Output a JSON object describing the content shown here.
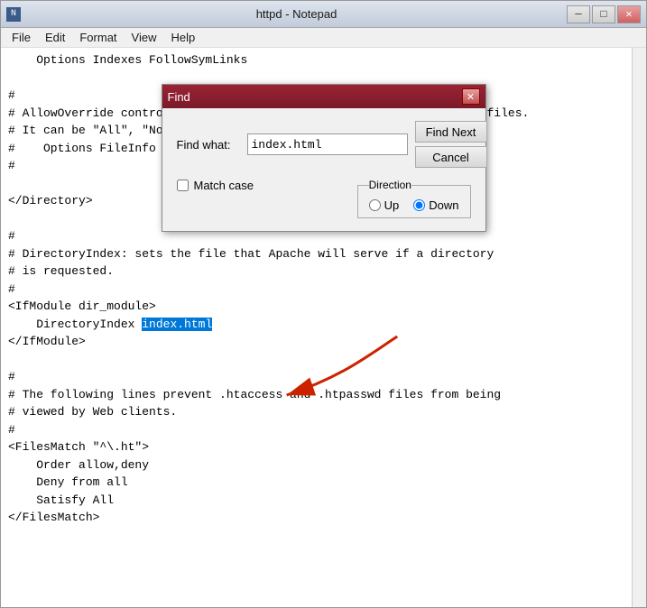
{
  "window": {
    "title": "httpd - Notepad",
    "icon": "N"
  },
  "titlebar": {
    "minimize_label": "─",
    "restore_label": "□",
    "close_label": "✕"
  },
  "menubar": {
    "items": [
      {
        "id": "file",
        "label": "File"
      },
      {
        "id": "edit",
        "label": "Edit"
      },
      {
        "id": "format",
        "label": "Format"
      },
      {
        "id": "view",
        "label": "View"
      },
      {
        "id": "help",
        "label": "Help"
      }
    ]
  },
  "editor": {
    "lines": [
      "    Options Indexes FollowSymLinks",
      "",
      "#",
      "# AllowOverride controls what directives may be placed in .htaccess files.",
      "# It can be \"All\", \"None\", or any combination of the keywords:",
      "#    Options FileInfo AuthConfig Limit",
      "#",
      "",
      "</Directory>",
      "",
      "#",
      "# DirectoryIndex: sets the file that Apache will serve if a directory",
      "# is requested.",
      "#",
      "<IfModule dir_module>",
      "    DirectoryIndex ",
      "</IfModule>",
      "",
      "#",
      "# The following lines prevent .htaccess and .htpasswd files from being",
      "# viewed by Web clients.",
      "#",
      "<FilesMatch \"^\\.ht\">",
      "    Order allow,deny",
      "    Deny from all",
      "    Satisfy All",
      "</FilesMatch>"
    ],
    "highlight_line": 15,
    "highlight_text": "index.html",
    "highlight_prefix": "    DirectoryIndex "
  },
  "find_dialog": {
    "title": "Find",
    "find_what_label": "Find what:",
    "find_what_value": "index.html",
    "find_next_label": "Find Next",
    "cancel_label": "Cancel",
    "direction_label": "Direction",
    "up_label": "Up",
    "down_label": "Down",
    "match_case_label": "Match case",
    "selected_direction": "Down"
  }
}
